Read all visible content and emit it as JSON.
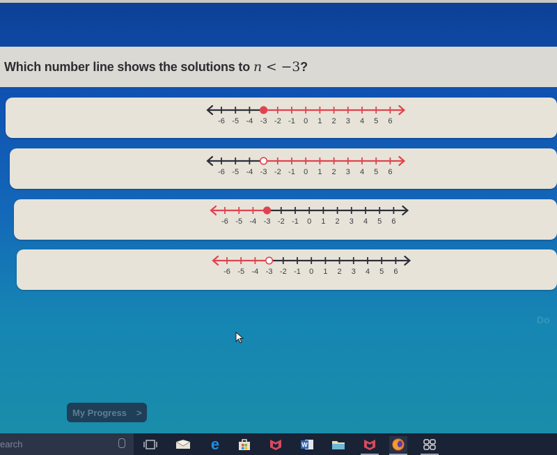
{
  "question": {
    "prefix": "Which number line shows the solutions to",
    "variable": "n",
    "relation": "<",
    "value": "−3",
    "suffix": "?"
  },
  "colors": {
    "highlight": "#e0434f",
    "line": "#2d2e38",
    "card": "#e7e3d8",
    "question_bg": "#dad9d3"
  },
  "number_line": {
    "ticks": [
      -6,
      -5,
      -4,
      -3,
      -2,
      -1,
      0,
      1,
      2,
      3,
      4,
      5,
      6
    ],
    "tick_labels": [
      "-6",
      "-5",
      "-4",
      "-3",
      "-2",
      "-1",
      "0",
      "1",
      "2",
      "3",
      "4",
      "5",
      "6"
    ]
  },
  "options": [
    {
      "id": "A",
      "point": -3,
      "endpoint": "closed",
      "shaded": "right",
      "inequality": "n ≥ -3"
    },
    {
      "id": "B",
      "point": -3,
      "endpoint": "open",
      "shaded": "right",
      "inequality": "n > -3"
    },
    {
      "id": "C",
      "point": -3,
      "endpoint": "closed",
      "shaded": "left",
      "inequality": "n ≤ -3"
    },
    {
      "id": "D",
      "point": -3,
      "endpoint": "open",
      "shaded": "left",
      "inequality": "n < -3"
    }
  ],
  "done_label": "Do",
  "progress_button": {
    "label": "My Progress",
    "chevron": ">"
  },
  "taskbar": {
    "search_placeholder": "earch",
    "icons": [
      {
        "name": "microphone-icon"
      },
      {
        "name": "task-view-icon"
      },
      {
        "name": "mail-icon"
      },
      {
        "name": "edge-icon"
      },
      {
        "name": "store-icon"
      },
      {
        "name": "mcafee-icon"
      },
      {
        "name": "word-icon"
      },
      {
        "name": "file-explorer-icon"
      },
      {
        "name": "mcafee-icon"
      },
      {
        "name": "firefox-icon"
      },
      {
        "name": "app-icon"
      }
    ]
  }
}
